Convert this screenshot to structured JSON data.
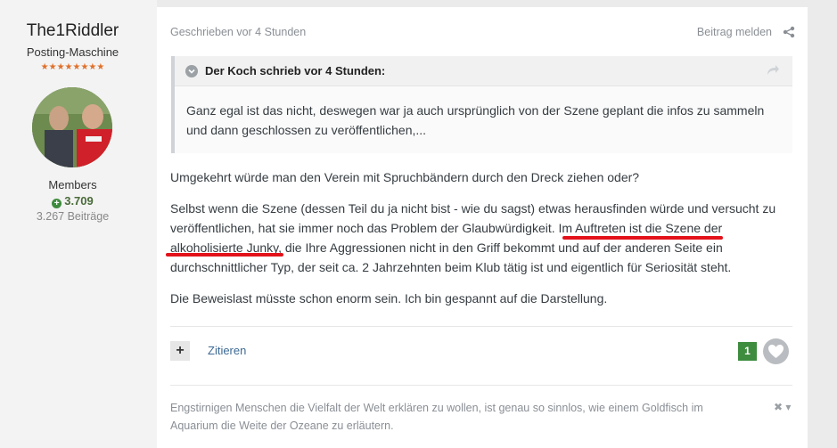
{
  "author": {
    "name": "The1Riddler",
    "rank": "Posting-Maschine",
    "stars": "★★★★★★★★",
    "group": "Members",
    "reputation": "3.709",
    "posts": "3.267 Beiträge"
  },
  "post": {
    "meta": "Geschrieben vor 4 Stunden",
    "report_label": "Beitrag melden",
    "quote": {
      "author_line": "Der Koch schrieb vor 4 Stunden:",
      "text": "Ganz egal ist das nicht, deswegen war ja auch ursprünglich von der Szene geplant die infos zu sammeln und dann geschlossen zu veröffentlichen,..."
    },
    "paragraphs": [
      "Umgekehrt würde man den Verein mit Spruchbändern durch den Dreck ziehen oder?",
      "Selbst wenn die Szene (dessen Teil du ja nicht bist - wie du sagst) etwas herausfinden würde und versucht zu veröffentlichen, hat sie immer noch das Problem der Glaubwürdigkeit. Im Auftreten ist die Szene der alkoholisierte Junky, die Ihre Aggressionen nicht in den Griff bekommt und auf der anderen Seite ein durchschnittlicher Typ, der seit ca. 2 Jahrzehnten beim Klub tätig ist und eigentlich für Seriosität steht.",
      "Die Beweislast müsste schon enorm sein. Ich bin gespannt auf die Darstellung."
    ],
    "plus_label": "+",
    "quote_button": "Zitieren",
    "reaction_count": "1",
    "signature": "Engstirnigen Menschen die Vielfalt der Welt erklären zu wollen, ist genau so sinnlos, wie einem Goldfisch im Aquarium die Weite der Ozeane zu erläutern.",
    "signature_controls": "✖ ▾"
  },
  "colors": {
    "accent_link": "#3d6a94",
    "reaction_green": "#3e8c3e",
    "annotation_red": "#e3121a",
    "stars_orange": "#e0702a"
  }
}
